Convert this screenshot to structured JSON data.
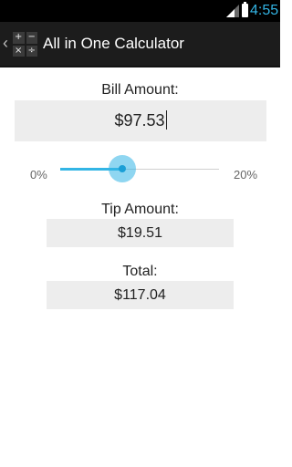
{
  "status_bar": {
    "time": "4:55",
    "signal_icon": "signal-icon",
    "battery_icon": "battery-icon"
  },
  "action_bar": {
    "back_icon": "chevron-left-icon",
    "app_icon": "calculator-icon",
    "app_icon_symbols": [
      "+",
      "−",
      "×",
      "÷"
    ],
    "title": "All in One Calculator"
  },
  "bill": {
    "label": "Bill Amount:",
    "value": "$97.53"
  },
  "tip_slider": {
    "min_label": "0%",
    "max_label": "20%",
    "value_fraction": 0.39,
    "accent_color": "#33b5e5"
  },
  "tip": {
    "label": "Tip Amount:",
    "value": "$19.51"
  },
  "total": {
    "label": "Total:",
    "value": "$117.04"
  }
}
